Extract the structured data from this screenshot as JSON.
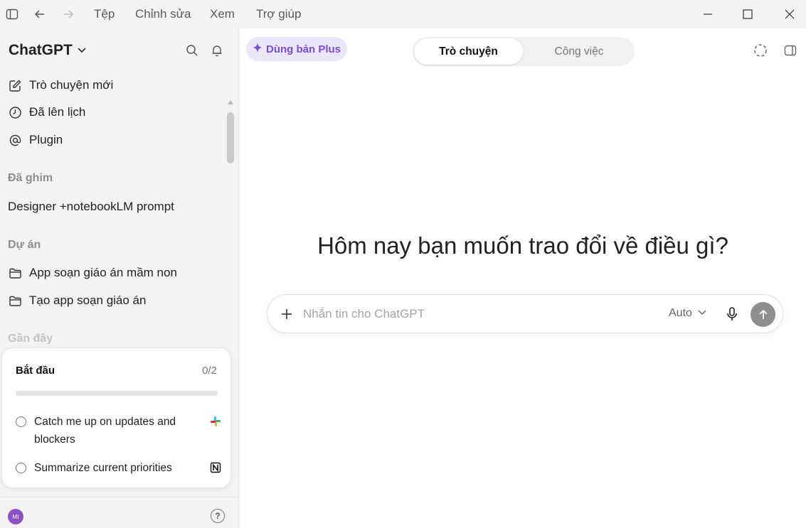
{
  "menu": {
    "file": "Tệp",
    "edit": "Chỉnh sửa",
    "view": "Xem",
    "help": "Trợ giúp"
  },
  "sidebar": {
    "brand": "ChatGPT",
    "nav": [
      {
        "label": "Trò chuyện mới",
        "icon": "compose-icon"
      },
      {
        "label": "Đã lên lịch",
        "icon": "clock-icon"
      },
      {
        "label": "Plugin",
        "icon": "at-sign-icon"
      }
    ],
    "pinned_title": "Đã ghim",
    "pinned_items": [
      "Designer +notebookLM prompt"
    ],
    "projects_title": "Dự án",
    "projects": [
      {
        "label": "App soạn giáo án mầm non",
        "icon": "folder-icon"
      },
      {
        "label": "Tạo app soạn giáo án",
        "icon": "folder-icon"
      }
    ],
    "recent_title": "Gần đây",
    "avatar_initials": "MI",
    "help_glyph": "?"
  },
  "onboarding": {
    "title": "Bắt đầu",
    "count": "0/2",
    "progress": 0,
    "tasks": [
      {
        "label": "Catch me up on updates and blockers",
        "app_icon": "slack-icon"
      },
      {
        "label": "Summarize current priorities",
        "app_icon": "notion-icon"
      }
    ]
  },
  "main": {
    "upgrade_label": "Dùng bản Plus",
    "tabs": [
      "Trò chuyện",
      "Công việc"
    ],
    "active_tab": "Trò chuyện",
    "headline": "Hôm nay bạn muốn trao đổi về điều gì?",
    "composer": {
      "placeholder": "Nhắn tin cho ChatGPT",
      "value": "",
      "model": "Auto"
    }
  },
  "colors": {
    "accent_purple": "#7a4cd9",
    "upgrade_bg": "#ece6fb",
    "avatar": "#8f4fc7",
    "send_button": "#8e8e8e"
  }
}
